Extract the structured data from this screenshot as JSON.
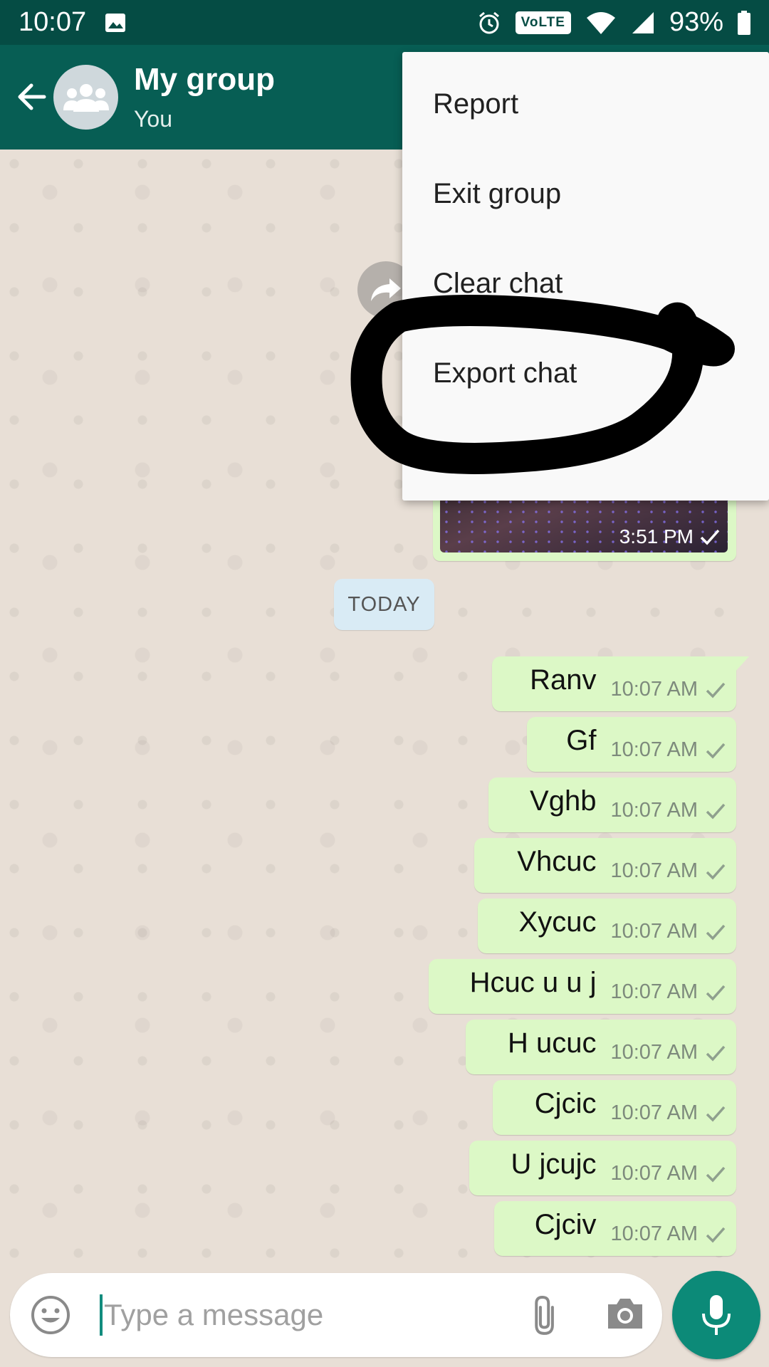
{
  "status_bar": {
    "time": "10:07",
    "volte": "VoLTE",
    "battery": "93%",
    "icons": [
      "image-icon",
      "alarm-icon",
      "wifi-icon",
      "signal-icon",
      "battery-icon"
    ]
  },
  "header": {
    "title": "My group",
    "subtitle": "You"
  },
  "menu": {
    "items": [
      {
        "label": "Report"
      },
      {
        "label": "Exit group"
      },
      {
        "label": "Clear chat"
      },
      {
        "label": "Export chat"
      },
      {
        "label": ""
      }
    ]
  },
  "image_message": {
    "time": "3:51 PM"
  },
  "date_chip": "TODAY",
  "messages": [
    {
      "text": "Ranv",
      "time": "10:07 AM"
    },
    {
      "text": "Gf",
      "time": "10:07 AM"
    },
    {
      "text": "Vghb",
      "time": "10:07 AM"
    },
    {
      "text": "Vhcuc",
      "time": "10:07 AM"
    },
    {
      "text": "Xycuc",
      "time": "10:07 AM"
    },
    {
      "text": "Hcuc u u j",
      "time": "10:07 AM"
    },
    {
      "text": "H ucuc",
      "time": "10:07 AM"
    },
    {
      "text": "Cjcic",
      "time": "10:07 AM"
    },
    {
      "text": "U jcujc",
      "time": "10:07 AM"
    },
    {
      "text": "Cjciv",
      "time": "10:07 AM"
    }
  ],
  "composer": {
    "placeholder": "Type a message",
    "value": ""
  },
  "colors": {
    "header": "#075e54",
    "status_bar": "#054c44",
    "outgoing_bubble": "#dcf8c6",
    "accent": "#0c8a78"
  }
}
